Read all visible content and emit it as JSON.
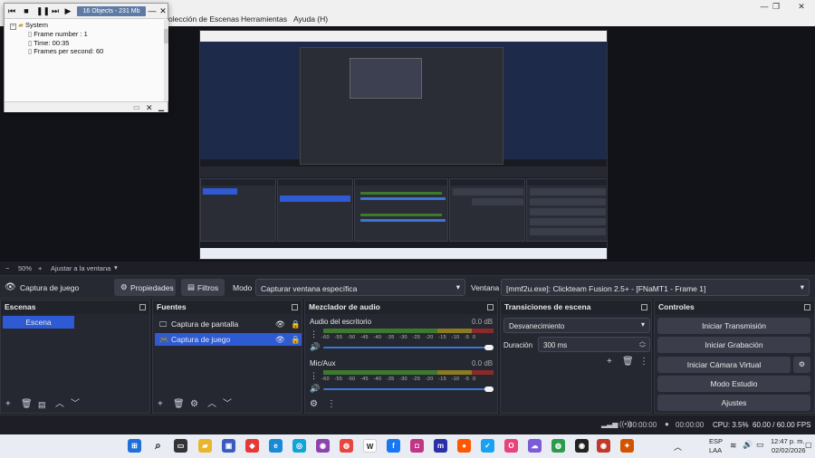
{
  "window": {
    "menu": [
      "olección de Escenas",
      "Herramientas",
      "Ayuda (H)"
    ]
  },
  "object_window": {
    "title": "16 Objects - 231 Mb",
    "tree": [
      {
        "label": "System",
        "level": 0
      },
      {
        "label": "Frame number : 1",
        "level": 1
      },
      {
        "label": "Time: 00:35",
        "level": 1
      },
      {
        "label": "Frames per second: 60",
        "level": 1
      }
    ]
  },
  "zoom": {
    "minus": "−",
    "value": "50%",
    "plus": "+",
    "fit_label": "Ajustar a la ventana"
  },
  "toolbar": {
    "source_name": "Captura de juego",
    "properties": "Propiedades",
    "filters": "Filtros",
    "mode_label": "Modo",
    "mode_value": "Capturar ventana específica",
    "window_label": "Ventana",
    "window_value": "[mmf2u.exe]: Clickteam Fusion 2.5+ - [FNaMT1 - Frame 1]"
  },
  "scenes": {
    "title": "Escenas",
    "items": [
      "Escena"
    ]
  },
  "sources": {
    "title": "Fuentes",
    "items": [
      {
        "label": "Captura de pantalla",
        "selected": false
      },
      {
        "label": "Captura de juego",
        "selected": true
      }
    ]
  },
  "mixer": {
    "title": "Mezclador de audio",
    "channels": [
      {
        "name": "Audio del escritorio",
        "db": "0.0 dB"
      },
      {
        "name": "Mic/Aux",
        "db": "0.0 dB"
      }
    ],
    "ticks": [
      "-60",
      "-55",
      "-50",
      "-45",
      "-40",
      "-35",
      "-30",
      "-25",
      "-20",
      "-15",
      "-10",
      "-5",
      "0"
    ]
  },
  "transitions": {
    "title": "Transiciones de escena",
    "type": "Desvanecimiento",
    "duration_label": "Duración",
    "duration_value": "300 ms"
  },
  "controls": {
    "title": "Controles",
    "buttons": [
      "Iniciar Transmisión",
      "Iniciar Grabación",
      "Iniciar Cámara Virtual",
      "Modo Estudio",
      "Ajustes"
    ]
  },
  "status": {
    "stream_time": "00:00:00",
    "rec_time": "00:00:00",
    "cpu": "CPU: 3.5%",
    "fps": "60.00 / 60.00 FPS"
  },
  "taskbar": {
    "lang_top": "ESP",
    "lang_bottom": "LAA",
    "time": "12:47 p. m.",
    "date": "02/02/2026"
  },
  "colors": {
    "accent": "#2e5bd4",
    "dock_bg": "#262831",
    "meter_green": "#3e7a2e",
    "meter_yellow": "#8a7a22",
    "meter_red": "#8a2a2a"
  }
}
